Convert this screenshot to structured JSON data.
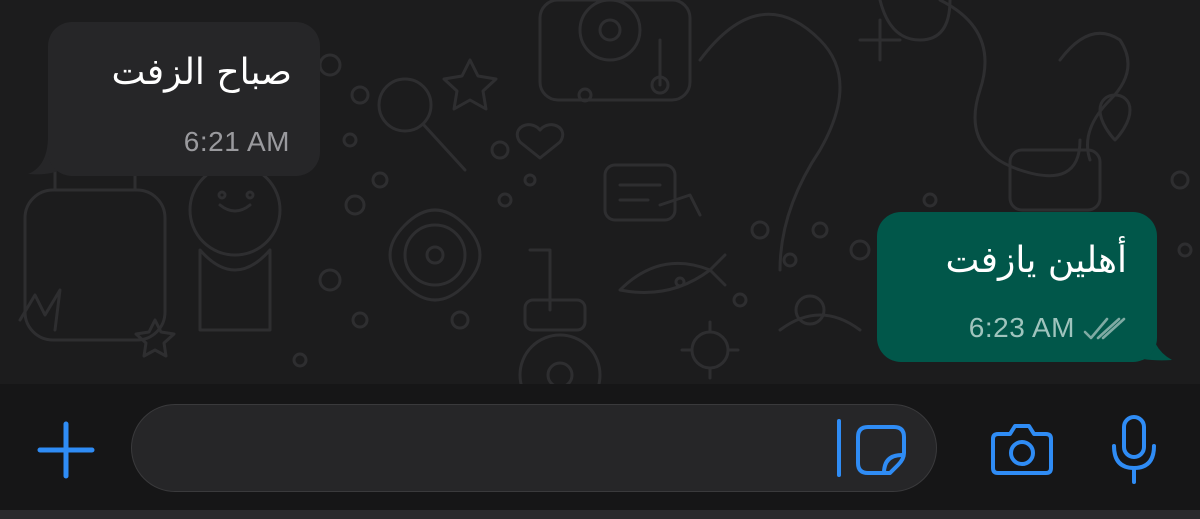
{
  "messages": [
    {
      "direction": "incoming",
      "text": "صباح الزفت",
      "time": "6:21 AM"
    },
    {
      "direction": "outgoing",
      "text": "أهلين يازفت",
      "time": "6:23 AM",
      "status": "read"
    }
  ],
  "composer": {
    "value": "",
    "placeholder": ""
  },
  "icons": {
    "attach": "plus-icon",
    "sticker": "sticker-icon",
    "camera": "camera-icon",
    "microphone": "microphone-icon",
    "read_receipt": "double-check-icon"
  },
  "colors": {
    "accent": "#2f8cf5",
    "outgoing_bubble": "#01574a",
    "incoming_bubble": "#262628",
    "background": "#1c1c1d"
  }
}
